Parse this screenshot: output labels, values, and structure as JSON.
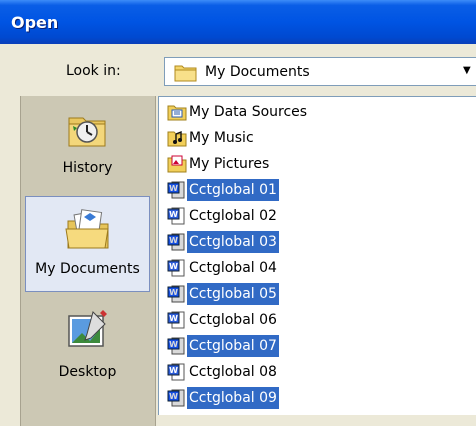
{
  "dialog": {
    "title": "Open"
  },
  "lookin": {
    "label": "Look in:",
    "value": "My Documents"
  },
  "places": [
    {
      "label": "History",
      "icon": "history-icon",
      "selected": false
    },
    {
      "label": "My Documents",
      "icon": "my-documents-icon",
      "selected": true
    },
    {
      "label": "Desktop",
      "icon": "desktop-icon",
      "selected": false
    }
  ],
  "files": [
    {
      "name": "My Data Sources",
      "icon": "folder-data-sources-icon",
      "selected": false
    },
    {
      "name": "My Music",
      "icon": "folder-music-icon",
      "selected": false
    },
    {
      "name": "My Pictures",
      "icon": "folder-pictures-icon",
      "selected": false
    },
    {
      "name": "Cctglobal 01",
      "icon": "word-document-icon",
      "selected": true
    },
    {
      "name": "Cctglobal 02",
      "icon": "word-document-icon",
      "selected": false
    },
    {
      "name": "Cctglobal 03",
      "icon": "word-document-icon",
      "selected": true
    },
    {
      "name": "Cctglobal 04",
      "icon": "word-document-icon",
      "selected": false
    },
    {
      "name": "Cctglobal 05",
      "icon": "word-document-icon",
      "selected": true
    },
    {
      "name": "Cctglobal 06",
      "icon": "word-document-icon",
      "selected": false
    },
    {
      "name": "Cctglobal 07",
      "icon": "word-document-icon",
      "selected": true
    },
    {
      "name": "Cctglobal 08",
      "icon": "word-document-icon",
      "selected": false
    },
    {
      "name": "Cctglobal 09",
      "icon": "word-document-icon",
      "selected": true
    }
  ],
  "colors": {
    "selection": "#316ac5",
    "titlebar": "#0054e3",
    "face": "#ece9d8"
  }
}
